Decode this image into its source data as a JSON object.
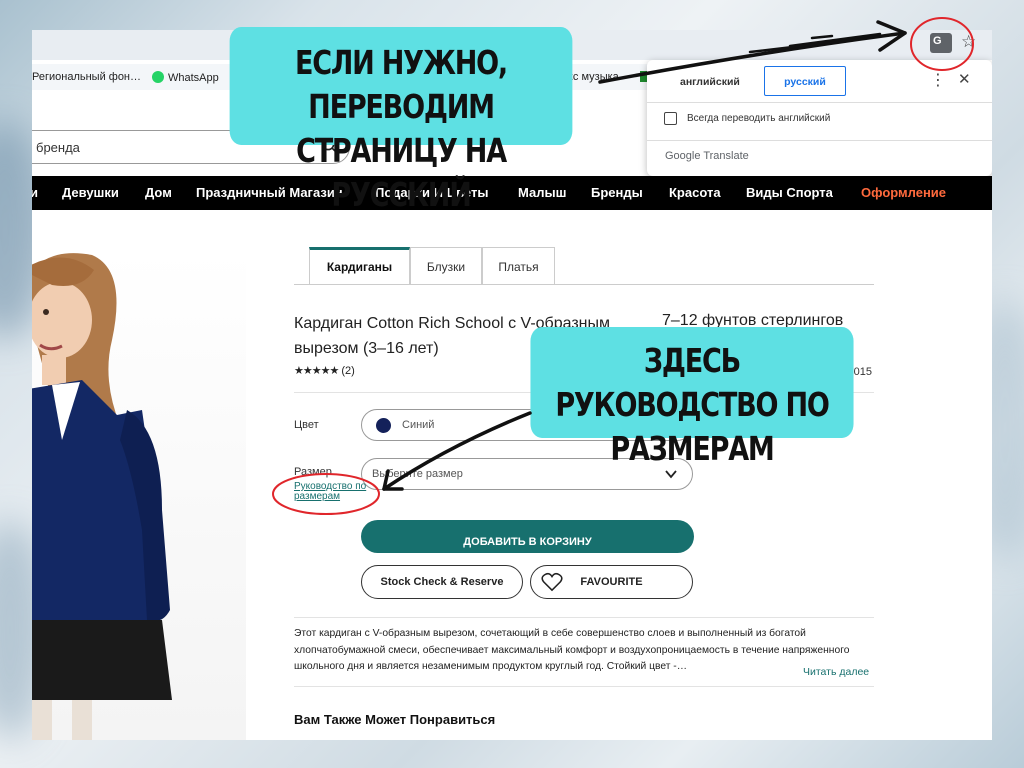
{
  "bookmarks": {
    "regional": "Региональный фон…",
    "whatsapp": "WhatsApp",
    "music": "кс музыка"
  },
  "search": {
    "value": "бренда"
  },
  "nav": {
    "items": [
      "и",
      "Девушки",
      "Дом",
      "Праздничный Магазин",
      "Подарки И Цветы",
      "Малыш",
      "Бренды",
      "Красота",
      "Виды Спорта",
      "Оформление"
    ]
  },
  "tabs": [
    "Кардиганы",
    "Блузки",
    "Платья"
  ],
  "product": {
    "title": "Кардиган Cotton Rich School с V-образным вырезом (3–16 лет)",
    "price": "7–12 фунтов стерлингов",
    "stars": "★★★★★",
    "reviews": "(2)",
    "code": "-015",
    "color_label": "Цвет",
    "color_value": "Синий",
    "size_label": "Размер",
    "size_placeholder": "Выберите размер",
    "size_guide": "Руководство по размерам",
    "add_to_cart": "ДОБАВИТЬ В КОРЗИНУ",
    "stock_check": "Stock Check & Reserve",
    "favourite": "FAVOURITE",
    "description": "Этот кардиган с V-образным вырезом, сочетающий в себе совершенство слоев и выполненный из богатой хлопчатобумажной смеси, обеспечивает максимальный комфорт и воздухопроницаемость в течение напряженного школьного дня и является незаменимым продуктом круглый год. Стойкий цвет -…",
    "read_more": "Читать далее",
    "also_like": "Вам Также Может Понравиться"
  },
  "translate_popup": {
    "source_lang": "английский",
    "target_lang": "русский",
    "always_translate": "Всегда переводить английский",
    "brand": "Google Translate"
  },
  "annotations": {
    "callout_translate": "ЕСЛИ НУЖНО, ПЕРЕВОДИМ СТРАНИЦУ НА РУССКИЙ",
    "callout_size_guide": "ЗДЕСЬ РУКОВОДСТВО ПО РАЗМЕРАМ"
  },
  "colors": {
    "accent_teal": "#17706e",
    "callout_bg": "#5ee0e3",
    "swatch_navy": "#14215a",
    "sale_orange": "#ff6a3d",
    "circle_red": "#e0262b"
  }
}
